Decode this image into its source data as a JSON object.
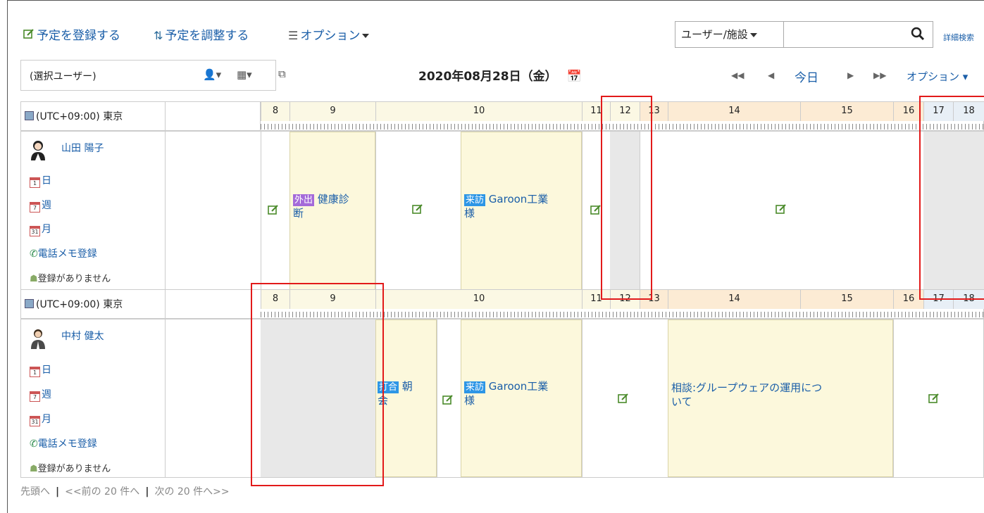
{
  "toolbar": {
    "register": "予定を登録する",
    "adjust": "予定を調整する",
    "options": "オプション"
  },
  "search": {
    "category": "ユーザー/施設",
    "advanced": "詳細検索"
  },
  "selector": {
    "user_select": "(選択ユーザー)"
  },
  "date": {
    "title": "2020年08月28日（金）",
    "today": "今日",
    "options": "オプション"
  },
  "hours": [
    "8",
    "9",
    "10",
    "11",
    "12",
    "13",
    "14",
    "15",
    "16",
    "17",
    "18"
  ],
  "timezone": "(UTC+09:00) 東京",
  "users": [
    {
      "name": "山田 陽子",
      "links": {
        "day": "日",
        "week": "週",
        "month": "月",
        "phone": "電話メモ登録"
      },
      "no_reg": "登録がありません",
      "events": [
        {
          "badge": "外出",
          "text": "健康診断",
          "line2": "断",
          "line1": "健康診"
        },
        {
          "badge": "来訪",
          "text": "Garoon工業様",
          "line1": "Garoon工業",
          "line2": "様"
        }
      ]
    },
    {
      "name": "中村 健太",
      "links": {
        "day": "日",
        "week": "週",
        "month": "月",
        "phone": "電話メモ登録"
      },
      "no_reg": "登録がありません",
      "events": [
        {
          "badge": "打合",
          "text": "朝会",
          "line1": "朝",
          "line2": "会"
        },
        {
          "badge": "来訪",
          "text": "Garoon工業様",
          "line1": "Garoon工業",
          "line2": "様"
        },
        {
          "badge": "",
          "text": "相談:グループウェアの運用について",
          "line1": "相談:グループウェアの運用につ",
          "line2": "いて"
        }
      ]
    }
  ],
  "pager": {
    "first": "先頭へ",
    "prev": "<<前の 20 件へ",
    "next": "次の 20 件へ>>"
  }
}
